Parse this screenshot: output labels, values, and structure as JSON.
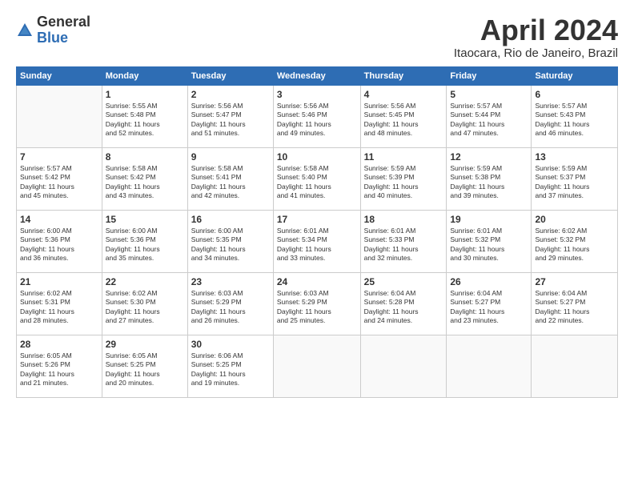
{
  "logo": {
    "general": "General",
    "blue": "Blue"
  },
  "title": {
    "month_year": "April 2024",
    "location": "Itaocara, Rio de Janeiro, Brazil"
  },
  "days_of_week": [
    "Sunday",
    "Monday",
    "Tuesday",
    "Wednesday",
    "Thursday",
    "Friday",
    "Saturday"
  ],
  "weeks": [
    [
      {
        "day": "",
        "info": ""
      },
      {
        "day": "1",
        "info": "Sunrise: 5:55 AM\nSunset: 5:48 PM\nDaylight: 11 hours\nand 52 minutes."
      },
      {
        "day": "2",
        "info": "Sunrise: 5:56 AM\nSunset: 5:47 PM\nDaylight: 11 hours\nand 51 minutes."
      },
      {
        "day": "3",
        "info": "Sunrise: 5:56 AM\nSunset: 5:46 PM\nDaylight: 11 hours\nand 49 minutes."
      },
      {
        "day": "4",
        "info": "Sunrise: 5:56 AM\nSunset: 5:45 PM\nDaylight: 11 hours\nand 48 minutes."
      },
      {
        "day": "5",
        "info": "Sunrise: 5:57 AM\nSunset: 5:44 PM\nDaylight: 11 hours\nand 47 minutes."
      },
      {
        "day": "6",
        "info": "Sunrise: 5:57 AM\nSunset: 5:43 PM\nDaylight: 11 hours\nand 46 minutes."
      }
    ],
    [
      {
        "day": "7",
        "info": "Sunrise: 5:57 AM\nSunset: 5:42 PM\nDaylight: 11 hours\nand 45 minutes."
      },
      {
        "day": "8",
        "info": "Sunrise: 5:58 AM\nSunset: 5:42 PM\nDaylight: 11 hours\nand 43 minutes."
      },
      {
        "day": "9",
        "info": "Sunrise: 5:58 AM\nSunset: 5:41 PM\nDaylight: 11 hours\nand 42 minutes."
      },
      {
        "day": "10",
        "info": "Sunrise: 5:58 AM\nSunset: 5:40 PM\nDaylight: 11 hours\nand 41 minutes."
      },
      {
        "day": "11",
        "info": "Sunrise: 5:59 AM\nSunset: 5:39 PM\nDaylight: 11 hours\nand 40 minutes."
      },
      {
        "day": "12",
        "info": "Sunrise: 5:59 AM\nSunset: 5:38 PM\nDaylight: 11 hours\nand 39 minutes."
      },
      {
        "day": "13",
        "info": "Sunrise: 5:59 AM\nSunset: 5:37 PM\nDaylight: 11 hours\nand 37 minutes."
      }
    ],
    [
      {
        "day": "14",
        "info": "Sunrise: 6:00 AM\nSunset: 5:36 PM\nDaylight: 11 hours\nand 36 minutes."
      },
      {
        "day": "15",
        "info": "Sunrise: 6:00 AM\nSunset: 5:36 PM\nDaylight: 11 hours\nand 35 minutes."
      },
      {
        "day": "16",
        "info": "Sunrise: 6:00 AM\nSunset: 5:35 PM\nDaylight: 11 hours\nand 34 minutes."
      },
      {
        "day": "17",
        "info": "Sunrise: 6:01 AM\nSunset: 5:34 PM\nDaylight: 11 hours\nand 33 minutes."
      },
      {
        "day": "18",
        "info": "Sunrise: 6:01 AM\nSunset: 5:33 PM\nDaylight: 11 hours\nand 32 minutes."
      },
      {
        "day": "19",
        "info": "Sunrise: 6:01 AM\nSunset: 5:32 PM\nDaylight: 11 hours\nand 30 minutes."
      },
      {
        "day": "20",
        "info": "Sunrise: 6:02 AM\nSunset: 5:32 PM\nDaylight: 11 hours\nand 29 minutes."
      }
    ],
    [
      {
        "day": "21",
        "info": "Sunrise: 6:02 AM\nSunset: 5:31 PM\nDaylight: 11 hours\nand 28 minutes."
      },
      {
        "day": "22",
        "info": "Sunrise: 6:02 AM\nSunset: 5:30 PM\nDaylight: 11 hours\nand 27 minutes."
      },
      {
        "day": "23",
        "info": "Sunrise: 6:03 AM\nSunset: 5:29 PM\nDaylight: 11 hours\nand 26 minutes."
      },
      {
        "day": "24",
        "info": "Sunrise: 6:03 AM\nSunset: 5:29 PM\nDaylight: 11 hours\nand 25 minutes."
      },
      {
        "day": "25",
        "info": "Sunrise: 6:04 AM\nSunset: 5:28 PM\nDaylight: 11 hours\nand 24 minutes."
      },
      {
        "day": "26",
        "info": "Sunrise: 6:04 AM\nSunset: 5:27 PM\nDaylight: 11 hours\nand 23 minutes."
      },
      {
        "day": "27",
        "info": "Sunrise: 6:04 AM\nSunset: 5:27 PM\nDaylight: 11 hours\nand 22 minutes."
      }
    ],
    [
      {
        "day": "28",
        "info": "Sunrise: 6:05 AM\nSunset: 5:26 PM\nDaylight: 11 hours\nand 21 minutes."
      },
      {
        "day": "29",
        "info": "Sunrise: 6:05 AM\nSunset: 5:25 PM\nDaylight: 11 hours\nand 20 minutes."
      },
      {
        "day": "30",
        "info": "Sunrise: 6:06 AM\nSunset: 5:25 PM\nDaylight: 11 hours\nand 19 minutes."
      },
      {
        "day": "",
        "info": ""
      },
      {
        "day": "",
        "info": ""
      },
      {
        "day": "",
        "info": ""
      },
      {
        "day": "",
        "info": ""
      }
    ]
  ]
}
